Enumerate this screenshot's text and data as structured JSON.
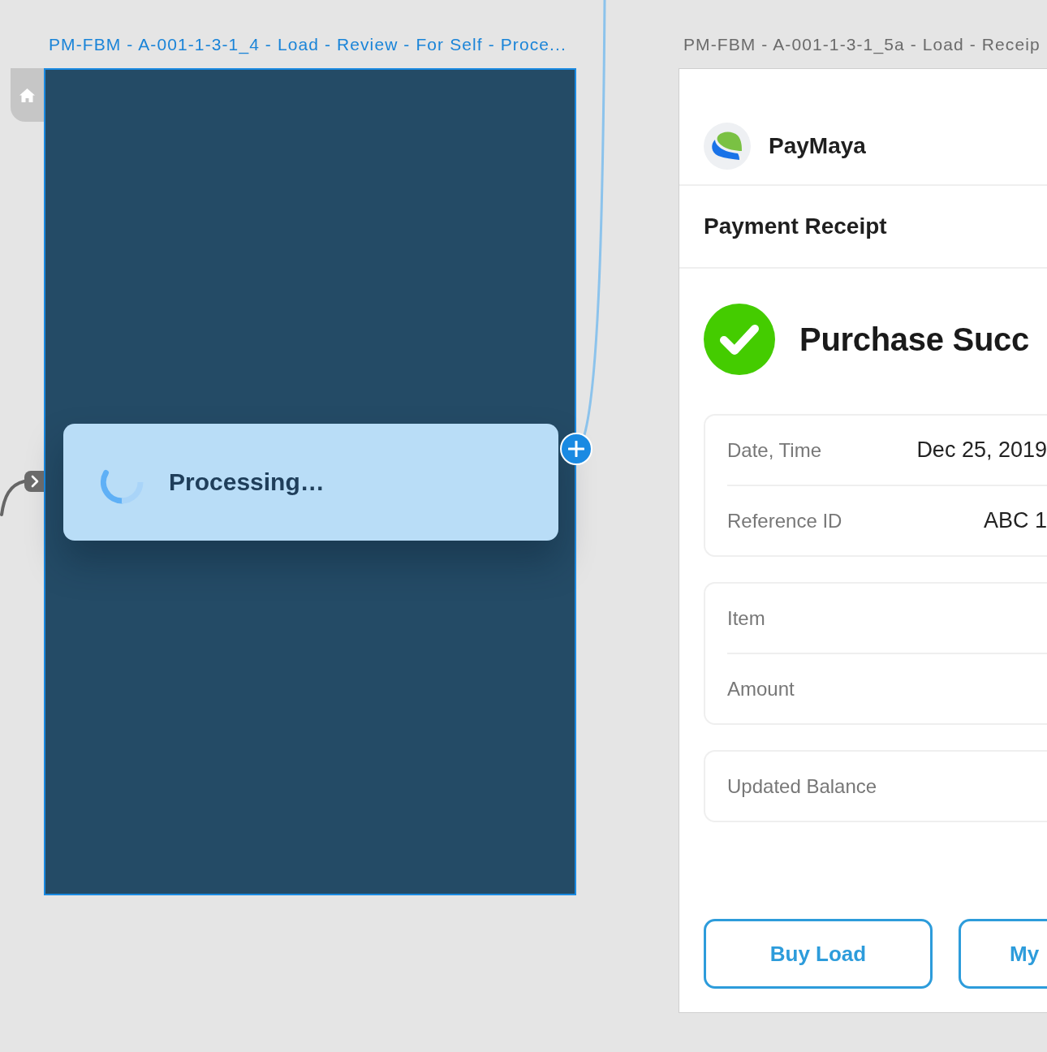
{
  "canvas": {
    "artboards": [
      {
        "kind": "loading",
        "label": "PM-FBM - A-001-1-3-1_4 - Load - Review - For Self - Proce...",
        "selected": true,
        "home": true,
        "message": "Processing…"
      },
      {
        "kind": "receipt",
        "label": "PM-FBM - A-001-1-3-1_5a - Load - Receip",
        "selected": false,
        "home": false,
        "brand": "PayMaya",
        "title": "Payment Receipt",
        "status": "Purchase Succ",
        "groups": [
          {
            "rows": [
              {
                "label": "Date, Time",
                "value": "Dec 25, 2019"
              },
              {
                "label": "Reference ID",
                "value": "ABC 1"
              }
            ]
          },
          {
            "rows": [
              {
                "label": "Item"
              },
              {
                "label": "Amount"
              }
            ]
          },
          {
            "rows": [
              {
                "label": "Updated Balance"
              }
            ]
          }
        ],
        "buttons": [
          "Buy Load",
          "My"
        ]
      }
    ]
  }
}
